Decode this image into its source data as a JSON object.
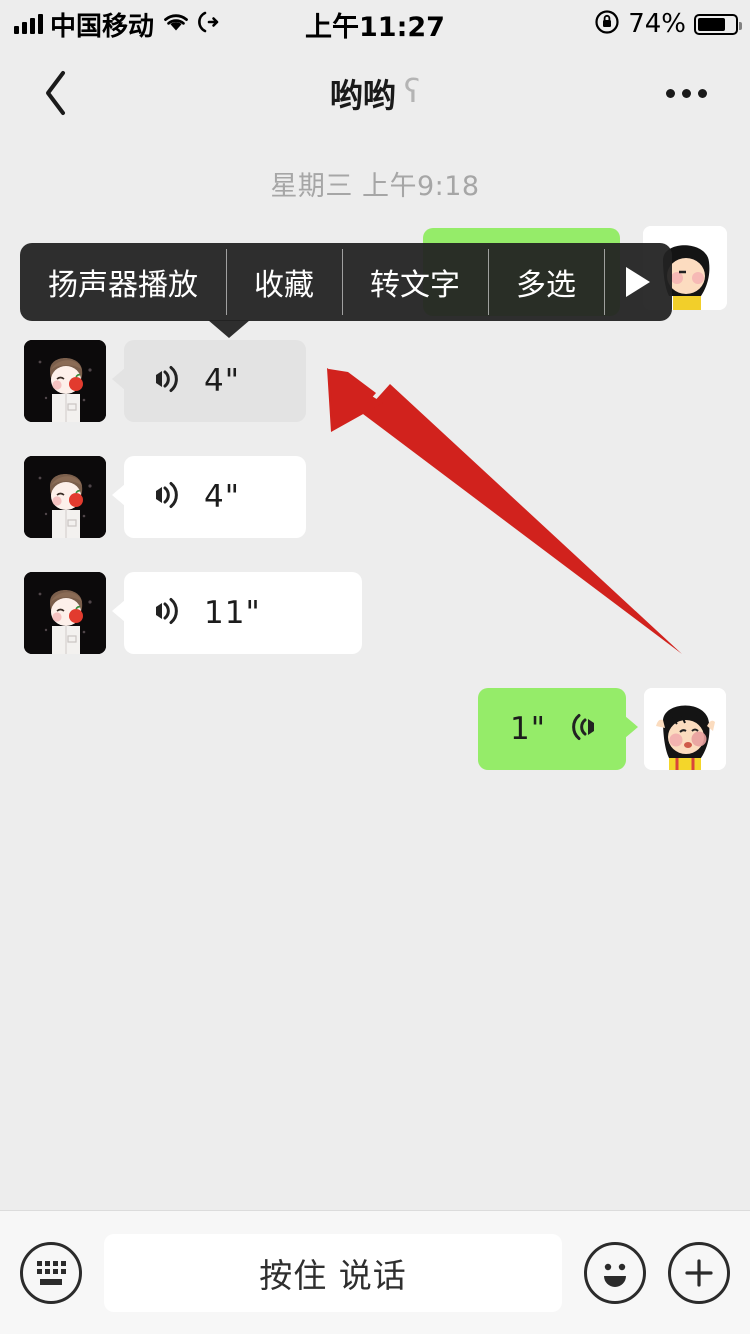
{
  "status_bar": {
    "carrier": "中国移动",
    "time": "上午11:27",
    "battery_pct": "74%",
    "signal_icon": "signal-bars-icon",
    "wifi_icon": "wifi-icon",
    "location_icon": "location-arrow-icon",
    "rotation_lock_icon": "rotation-lock-icon",
    "battery_icon": "battery-icon"
  },
  "navbar": {
    "back_icon": "back-chevron-icon",
    "title": "哟哟",
    "title_badge": "ʕ",
    "more_icon": "more-dots-icon"
  },
  "chat": {
    "daystamp": "星期三 上午9:18",
    "messages": [
      {
        "id": "msg-hidden-out",
        "side": "out",
        "duration": "",
        "kind": "voice",
        "note": "behind-menu"
      },
      {
        "id": "msg-1",
        "side": "in",
        "duration": "4\"",
        "kind": "voice",
        "selected": true
      },
      {
        "id": "msg-2",
        "side": "in",
        "duration": "4\"",
        "kind": "voice",
        "selected": false
      },
      {
        "id": "msg-3",
        "side": "in",
        "duration": "11\"",
        "kind": "voice",
        "selected": false
      },
      {
        "id": "msg-4",
        "side": "out",
        "duration": "1\"",
        "kind": "voice",
        "selected": false
      }
    ]
  },
  "context_menu": {
    "items": [
      {
        "label": "扬声器播放",
        "name": "menu-item-speaker-play"
      },
      {
        "label": "收藏",
        "name": "menu-item-favorite"
      },
      {
        "label": "转文字",
        "name": "menu-item-convert-text"
      },
      {
        "label": "多选",
        "name": "menu-item-multi-select"
      }
    ],
    "next_icon": "play-triangle-icon"
  },
  "annotation": {
    "arrow_color": "#d1221d",
    "arrow_icon": "red-pointer-arrow"
  },
  "input_bar": {
    "keyboard_icon": "keyboard-icon",
    "talk_label": "按住 说话",
    "emoji_icon": "smiley-icon",
    "plus_icon": "plus-icon"
  },
  "colors": {
    "background": "#ededed",
    "bubble_in": "#ffffff",
    "bubble_in_selected": "#e3e3e3",
    "bubble_out": "#95ec69",
    "menu_bg": "#222222",
    "accent_red": "#d1221d"
  }
}
